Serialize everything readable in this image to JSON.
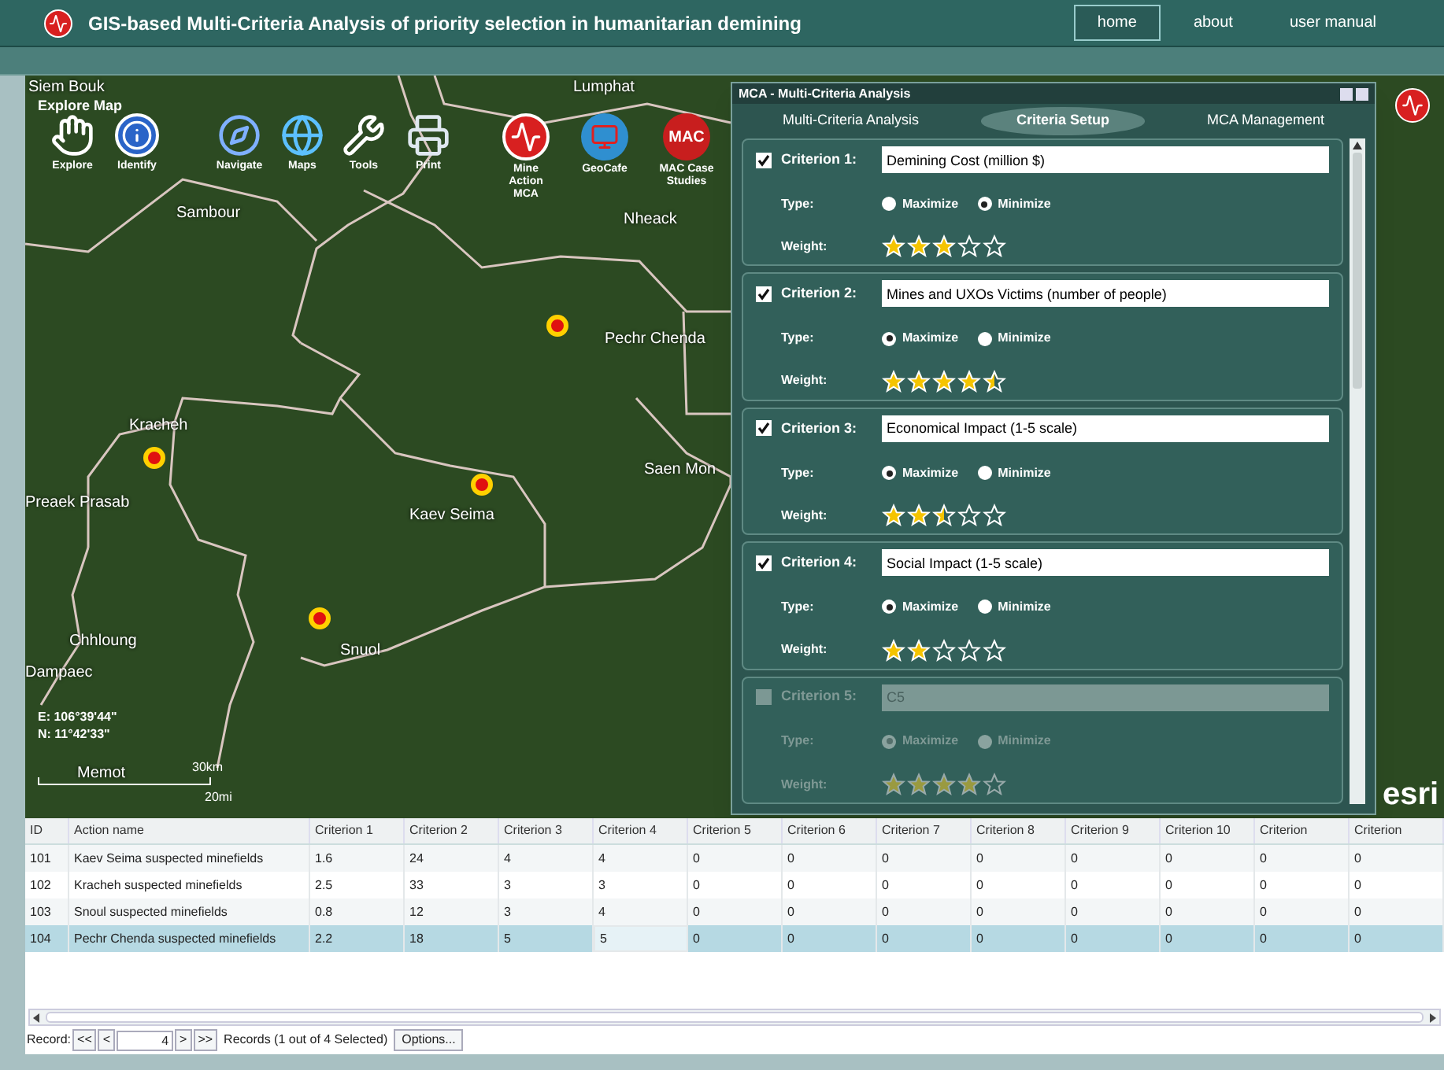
{
  "header": {
    "title": "GIS-based Multi-Criteria Analysis of priority selection in humanitarian demining",
    "nav": [
      {
        "label": "home",
        "selected": true
      },
      {
        "label": "about",
        "selected": false
      },
      {
        "label": "user manual",
        "selected": false
      }
    ]
  },
  "map": {
    "title": "Explore Map",
    "tools": [
      {
        "kind": "hand",
        "label": "Explore"
      },
      {
        "kind": "info",
        "label": "Identify"
      },
      {
        "kind": "compass",
        "label": "Navigate"
      },
      {
        "kind": "globe",
        "label": "Maps"
      },
      {
        "kind": "tools",
        "label": "Tools"
      },
      {
        "kind": "printer",
        "label": "Print"
      },
      {
        "kind": "pulse",
        "label": "Mine Action MCA"
      },
      {
        "kind": "geo",
        "label": "GeoCafe"
      },
      {
        "kind": "mac",
        "label": "MAC Case Studies",
        "icon_text": "MAC"
      }
    ],
    "places": [
      "Siem Bouk",
      "Lumphat",
      "Sambour",
      "Nheack",
      "Pechr Chenda",
      "Kracheh",
      "Preaek Prasab",
      "Kaev Seima",
      "Saen Mon",
      "Chhloung",
      "Dampaec",
      "Snuol",
      "Memot"
    ],
    "coordinates": [
      "E: 106°39'44\"",
      "N: 11°42'33\""
    ],
    "scale": [
      "30km",
      "20mi"
    ],
    "logo": "esri"
  },
  "mca_panel": {
    "title": "MCA - Multi-Criteria Analysis",
    "tabs": [
      {
        "label": "Multi-Criteria Analysis",
        "selected": false
      },
      {
        "label": "Criteria Setup",
        "selected": true
      },
      {
        "label": "MCA Management",
        "selected": false
      }
    ],
    "criteria": [
      {
        "label": "Criterion 1:",
        "value": "Demining Cost (million $)",
        "checked": true,
        "disabled": false,
        "type_label": "Type:",
        "weight_label": "Weight:",
        "options": [
          {
            "label": "Maximize",
            "selected": false
          },
          {
            "label": "Minimize",
            "selected": true
          }
        ],
        "stars": 3
      },
      {
        "label": "Criterion 2:",
        "value": "Mines and UXOs Victims (number of people)",
        "checked": true,
        "disabled": false,
        "type_label": "Type:",
        "weight_label": "Weight:",
        "options": [
          {
            "label": "Maximize",
            "selected": true
          },
          {
            "label": "Minimize",
            "selected": false
          }
        ],
        "stars": 4.5
      },
      {
        "label": "Criterion 3:",
        "value": "Economical Impact (1-5 scale)",
        "checked": true,
        "disabled": false,
        "type_label": "Type:",
        "weight_label": "Weight:",
        "options": [
          {
            "label": "Maximize",
            "selected": true
          },
          {
            "label": "Minimize",
            "selected": false
          }
        ],
        "stars": 2.5
      },
      {
        "label": "Criterion 4:",
        "value": "Social Impact (1-5 scale)",
        "checked": true,
        "disabled": false,
        "type_label": "Type:",
        "weight_label": "Weight:",
        "options": [
          {
            "label": "Maximize",
            "selected": true
          },
          {
            "label": "Minimize",
            "selected": false
          }
        ],
        "stars": 2
      },
      {
        "label": "Criterion 5:",
        "value": "C5",
        "checked": false,
        "disabled": true,
        "type_label": "Type:",
        "weight_label": "Weight:",
        "options": [
          {
            "label": "Maximize",
            "selected": true
          },
          {
            "label": "Minimize",
            "selected": false
          }
        ],
        "stars": 4
      }
    ]
  },
  "table": {
    "columns": [
      "ID",
      "Action name",
      "Criterion 1",
      "Criterion 2",
      "Criterion 3",
      "Criterion 4",
      "Criterion 5",
      "Criterion 6",
      "Criterion 7",
      "Criterion 8",
      "Criterion 9",
      "Criterion 10",
      "Criterion",
      "Criterion"
    ],
    "rows": [
      {
        "selected": false,
        "cells": [
          "101",
          "Kaev Seima suspected minefields",
          "1.6",
          "24",
          "4",
          "4",
          "0",
          "0",
          "0",
          "0",
          "0",
          "0",
          "0",
          "0"
        ]
      },
      {
        "selected": false,
        "cells": [
          "102",
          "Kracheh suspected minefields",
          "2.5",
          "33",
          "3",
          "3",
          "0",
          "0",
          "0",
          "0",
          "0",
          "0",
          "0",
          "0"
        ]
      },
      {
        "selected": false,
        "cells": [
          "103",
          "Snoul suspected minefields",
          "0.8",
          "12",
          "3",
          "4",
          "0",
          "0",
          "0",
          "0",
          "0",
          "0",
          "0",
          "0"
        ]
      },
      {
        "selected": true,
        "cells": [
          "104",
          "Pechr Chenda suspected minefields",
          "2.2",
          "18",
          "5",
          {
            "text": "5",
            "editing": true
          },
          "0",
          "0",
          "0",
          "0",
          "0",
          "0",
          "0",
          "0"
        ]
      }
    ]
  },
  "pager": {
    "label": "Record:",
    "first": "<<",
    "prev": "<",
    "value": "4",
    "next": ">",
    "last": ">>",
    "status": "Records (1 out of 4 Selected)",
    "options": "Options..."
  }
}
